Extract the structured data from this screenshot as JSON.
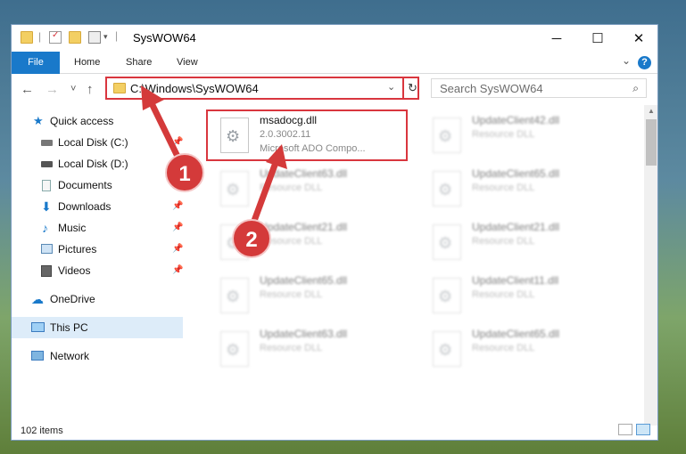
{
  "window": {
    "title": "SysWOW64",
    "minimize": "─",
    "maximize": "☐",
    "close": "✕"
  },
  "ribbon": {
    "tabs": [
      "File",
      "Home",
      "Share",
      "View"
    ],
    "help": "?"
  },
  "nav": {
    "back": "←",
    "forward": "→",
    "recent": "˅",
    "up": "↑"
  },
  "address": {
    "path": "C:\\Windows\\SysWOW64",
    "dropdown": "⌄",
    "refresh": "↻"
  },
  "search": {
    "placeholder": "Search SysWOW64",
    "icon": "⌕"
  },
  "sidebar": [
    {
      "label": "Quick access",
      "icon": "star-icon",
      "pinned": false
    },
    {
      "label": "Local Disk (C:)",
      "icon": "drive-icon",
      "pinned": true
    },
    {
      "label": "Local Disk (D:)",
      "icon": "drive-icon",
      "pinned": true
    },
    {
      "label": "Documents",
      "icon": "documents-icon",
      "pinned": true
    },
    {
      "label": "Downloads",
      "icon": "download-icon",
      "pinned": true
    },
    {
      "label": "Music",
      "icon": "music-icon",
      "pinned": true
    },
    {
      "label": "Pictures",
      "icon": "pictures-icon",
      "pinned": true
    },
    {
      "label": "Videos",
      "icon": "videos-icon",
      "pinned": true
    },
    {
      "label": "OneDrive",
      "icon": "cloud-icon",
      "pinned": false
    },
    {
      "label": "This PC",
      "icon": "computer-icon",
      "pinned": false,
      "selected": true
    },
    {
      "label": "Network",
      "icon": "network-icon",
      "pinned": false
    }
  ],
  "files": [
    {
      "name": "msadocg.dll",
      "version": "2.0.3002.11",
      "desc": "Microsoft ADO Compo..."
    },
    {
      "name": "UpdateClient42.dll",
      "desc": "Resource DLL"
    },
    {
      "name": "UpdateClient63.dll",
      "desc": "Resource DLL"
    },
    {
      "name": "UpdateClient65.dll",
      "desc": "Resource DLL"
    },
    {
      "name": "UpdateClient21.dll",
      "desc": "Resource DLL"
    },
    {
      "name": "UpdateClient21.dll",
      "desc": "Resource DLL"
    },
    {
      "name": "UpdateClient65.dll",
      "desc": "Resource DLL"
    },
    {
      "name": "UpdateClient11.dll",
      "desc": "Resource DLL"
    },
    {
      "name": "UpdateClient63.dll",
      "desc": "Resource DLL"
    },
    {
      "name": "UpdateClient65.dll",
      "desc": "Resource DLL"
    }
  ],
  "status": {
    "count": "102 items"
  },
  "annotations": {
    "step1": "1",
    "step2": "2"
  },
  "colors": {
    "accent": "#1979ca",
    "highlight": "#d9363e",
    "selected": "#ddecf9"
  }
}
